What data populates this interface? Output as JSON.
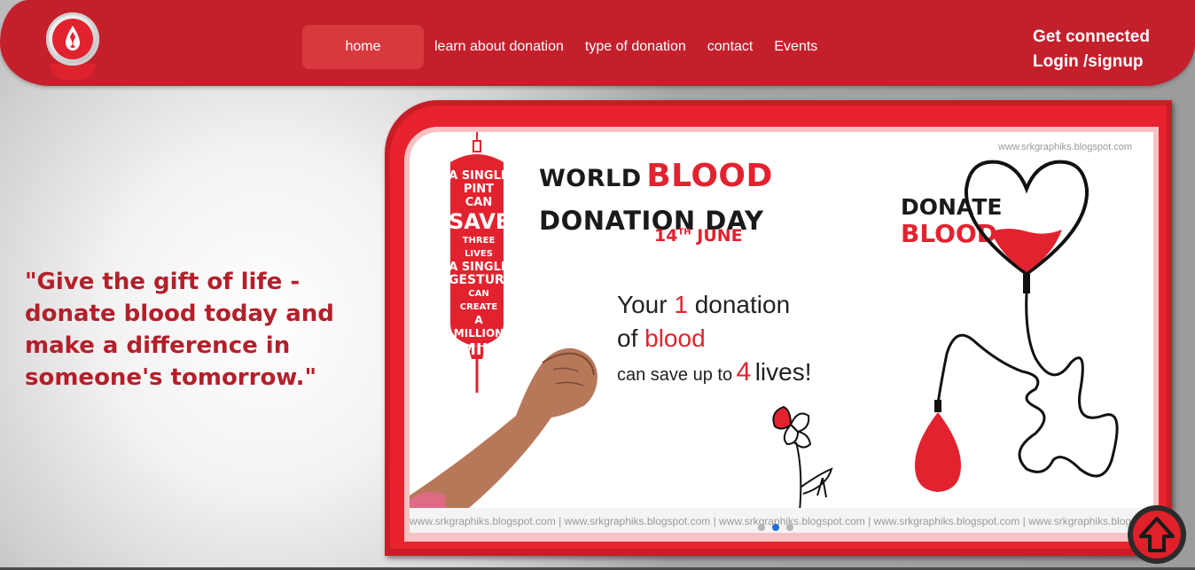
{
  "nav": {
    "home_label": "home",
    "learn_label": "learn about donation",
    "type_label": "type of donation",
    "contact_label": "contact",
    "events_label": "Events"
  },
  "header_right": {
    "get_connected": "Get connected",
    "login_signup": "Login /signup"
  },
  "quote": "\"Give the gift of life - donate blood today and make a difference in someone's tomorrow.\"",
  "slide": {
    "watermark_top": "www.srkgraphiks.blogspot.com",
    "watermark_bottom": "www.srkgraphiks.blogspot.com | www.srkgraphiks.blogspot.com | www.srkgraphiks.blogspot.com | www.srkgraphiks.blogspot.com | www.srkgraphiks.blogspot.com",
    "bag_text": [
      "A SINGLE",
      "PINT CAN",
      "SAVE",
      "THREE LIVES",
      "A SINGLE",
      "GESTURE",
      "CAN CREATE",
      "A MILLION",
      "SMILES"
    ],
    "title_world": "WORLD",
    "title_blood": "BLOOD",
    "title_day": "DONATION DAY",
    "date_day": "14",
    "date_suffix": "TH",
    "date_month": "JUNE",
    "line1_a": "Your",
    "line1_num": "1",
    "line1_b": "donation",
    "line2_a": "of",
    "line2_b": "blood",
    "line3_a": "can save up to",
    "line3_num": "4",
    "line3_b": "lives!",
    "donate_word": "DONATE",
    "blood_word": "BLOOD"
  },
  "carousel": {
    "slide_count": 3,
    "active_index": 1
  },
  "colors": {
    "brand_red": "#c4202c",
    "accent_red": "#e2232f",
    "quote_red": "#b3202a",
    "dot_active": "#1e6fd8"
  },
  "icons": {
    "logo": "blood-drop-logo-icon",
    "scroll_top": "arrow-up-icon"
  }
}
